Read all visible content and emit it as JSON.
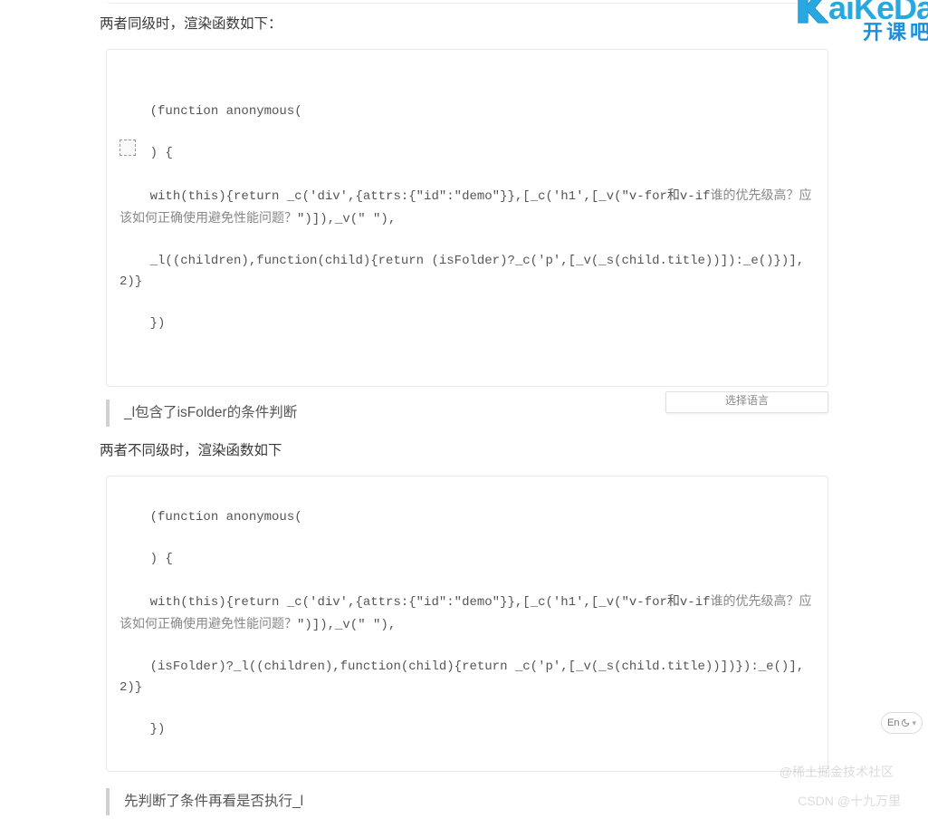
{
  "brand": {
    "en": "aiKeDa",
    "cn": "开课吧"
  },
  "para1": "两者同级时，渲染函数如下：",
  "code1": {
    "l1": "(function anonymous(",
    "l2": ") {",
    "l3a": "with(this){return _c('div',{attrs:{\"id\":\"demo\"}},[_c('h1',[_v(\"v-for和v-if",
    "l3b": "谁的优先级高？应该如何正确使用避免性能问题？",
    "l3c": "\")]),_v(\" \"),",
    "l4": "_l((children),function(child){return (isFolder)?_c('p',[_v(_s(child.title))]):_e()})],2)}",
    "l5": "})"
  },
  "lang_selector": "选择语言",
  "quote1": "_l包含了isFolder的条件判断",
  "para2": "两者不同级时，渲染函数如下",
  "code2": {
    "l1": "(function anonymous(",
    "l2": ") {",
    "l3a": "with(this){return _c('div',{attrs:{\"id\":\"demo\"}},[_c('h1',[_v(\"v-for和v-if",
    "l3b": "谁的优先级高？应该如何正确使用避免性能问题？",
    "l3c": "\")]),_v(\" \"),",
    "l4": "(isFolder)?_l((children),function(child){return _c('p',[_v(_s(child.title))])}):_e()],2)}",
    "l5": "})"
  },
  "quote2": "先判断了条件再看是否执行_l",
  "lang_badge": "En",
  "watermark1": "@稀土掘金技术社区",
  "watermark2": "CSDN @十九万里",
  "colors": {
    "brand_blue": "#1c8fd8",
    "brand_cyan": "#29a8e0"
  }
}
